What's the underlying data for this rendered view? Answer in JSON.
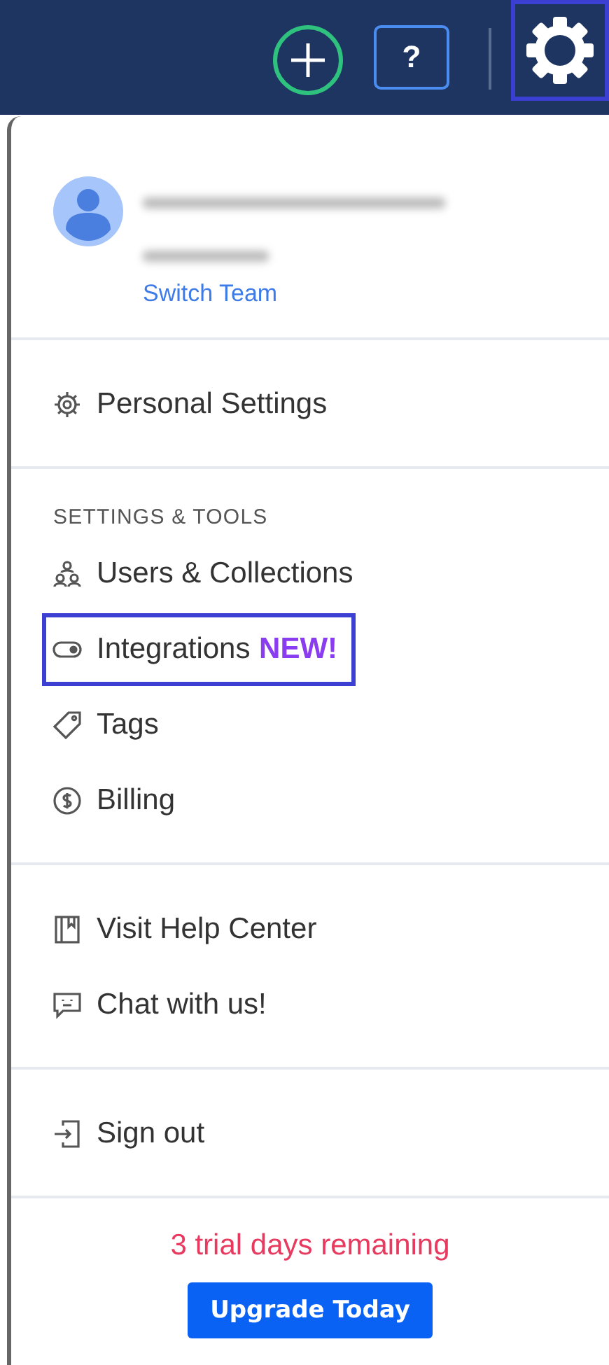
{
  "header": {
    "buttons": [
      {
        "kind": "add",
        "highlighted": false
      },
      {
        "kind": "help",
        "label": "?",
        "highlighted": false
      },
      {
        "kind": "settings",
        "highlighted": true
      }
    ]
  },
  "account": {
    "link": "Switch Team"
  },
  "sections": [
    {
      "items": [
        {
          "label": "Personal Settings",
          "highlighted": false
        }
      ]
    },
    {
      "heading": "SETTINGS & TOOLS",
      "items": [
        {
          "label": "Users & Collections",
          "highlighted": false
        },
        {
          "label": "Integrations",
          "badge": "NEW!",
          "highlighted": true
        },
        {
          "label": "Tags",
          "highlighted": false
        },
        {
          "label": "Billing",
          "highlighted": false
        }
      ]
    },
    {
      "items": [
        {
          "label": "Visit Help Center",
          "highlighted": false
        },
        {
          "label": "Chat with us!",
          "highlighted": false
        }
      ]
    },
    {
      "items": [
        {
          "label": "Sign out",
          "highlighted": false
        }
      ]
    }
  ],
  "trial": {
    "notice": "3 trial days remaining",
    "button": "Upgrade Today"
  }
}
